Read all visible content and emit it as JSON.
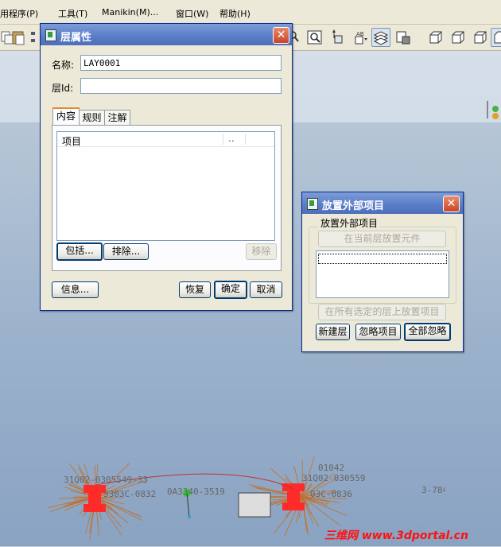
{
  "menubar": {
    "items": [
      "用程序(P)",
      "工具(T)",
      "Manikin(M)...",
      "窗口(W)",
      "帮助(H)"
    ]
  },
  "toolbar": {
    "icons": [
      "paste-icon",
      "tree-icon",
      "zoom-icon",
      "orient-icon",
      "view-icon",
      "layer-icon",
      "model-icon",
      "cube-icon",
      "cube-icon",
      "cube-icon",
      "cube-icon"
    ]
  },
  "layer_dialog": {
    "title": "层属性",
    "name_label": "名称:",
    "name_value": "LAY0001",
    "id_label": "层Id:",
    "id_value": "",
    "tabs": [
      "内容",
      "规则",
      "注解"
    ],
    "list_header": "项目",
    "list_header_extra": "..",
    "include_btn": "包括...",
    "exclude_btn": "排除...",
    "remove_btn": "移除",
    "info_btn": "信息...",
    "restore_btn": "恢复",
    "ok_btn": "确定",
    "cancel_btn": "取消"
  },
  "place_dialog": {
    "title": "放置外部项目",
    "group_label": "放置外部项目",
    "place_current_btn": "在当前层放置元件",
    "place_all_btn": "在所有选定的层上放置项目",
    "new_layer_btn": "新建层",
    "ignore_btn": "忽略项目",
    "ignore_all_btn": "全部忽略"
  },
  "scene": {
    "labels": [
      "31Q02-0305549-33",
      "3303C-0832",
      "0A3340-3519",
      "31Q02-030559",
      "03C-0836",
      "3-784",
      "01042"
    ]
  },
  "watermark": "三维网 www.3dportal.cn"
}
